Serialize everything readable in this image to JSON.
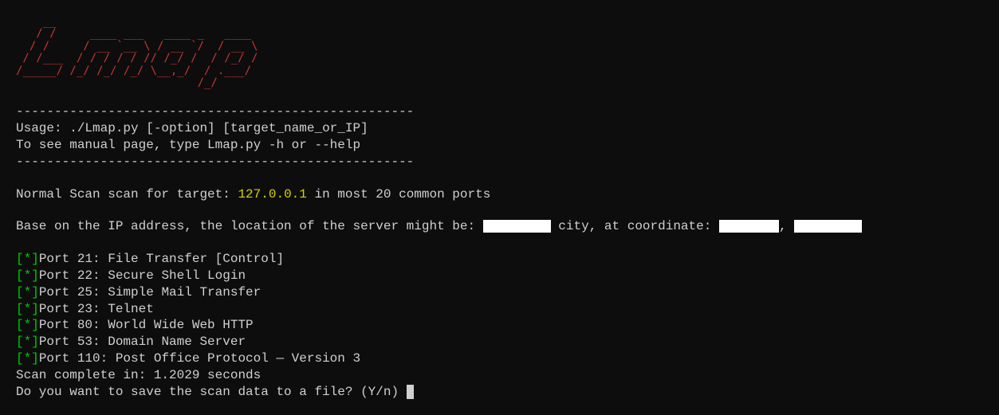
{
  "logo_ascii": "    __                                \n   / /     ____ ___   ____ _   ____   \n  / /     / __ `__ \\ / __ `/  / __ \\  \n / /___  / / / / / // /_/ /  / /_/ /  \n/_____/ /_/ /_/ /_/ \\__,_/  / .___/   \n                           /_/        ",
  "divider": "----------------------------------------------------",
  "usage": "Usage: ./Lmap.py [-option] [target_name_or_IP]",
  "help": "To see manual page, type Lmap.py -h or --help",
  "scan_prefix": "Normal Scan scan for target: ",
  "target_ip": "127.0.0.1",
  "scan_suffix": " in most 20 common ports",
  "location_prefix": "Base on the IP address, the location of the server might be: ",
  "location_city_label": " city, at coordinate: ",
  "location_comma": ", ",
  "port_marker": "[*]",
  "ports": [
    "Port 21: File Transfer [Control]",
    "Port 22: Secure Shell Login",
    "Port 25: Simple Mail Transfer",
    "Port 23: Telnet",
    "Port 80: World Wide Web HTTP",
    "Port 53: Domain Name Server",
    "Port 110: Post Office Protocol — Version 3"
  ],
  "scan_complete": "Scan complete in: 1.2029 seconds",
  "save_prompt": "Do you want to save the scan data to a file? (Y/n) "
}
